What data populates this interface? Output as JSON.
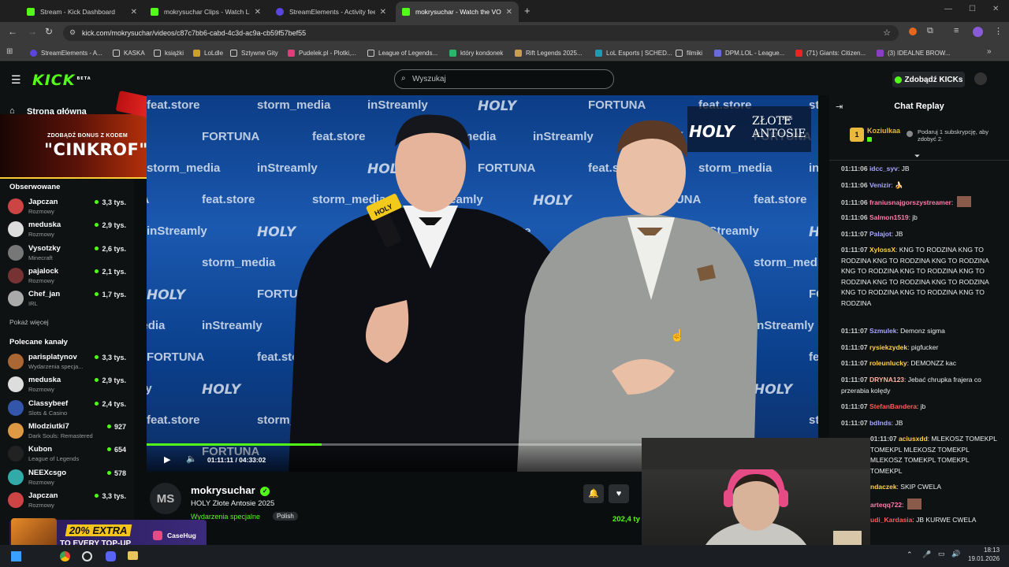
{
  "browser": {
    "tabs": [
      {
        "label": "Stream - Kick Dashboard",
        "color": "#53fc18",
        "active": false
      },
      {
        "label": "mokrysuchar Clips - Watch Live",
        "color": "#53fc18",
        "active": false
      },
      {
        "label": "StreamElements - Activity feed",
        "color": "#5b45e0",
        "active": false
      },
      {
        "label": "mokrysuchar - Watch the VOD",
        "color": "#53fc18",
        "active": true
      }
    ],
    "new_tab_icon": "plus-icon",
    "url": "kick.com/mokrysuchar/videos/c87c7bb6-cabd-4c3d-ac9a-cb59f57bef55",
    "bookmarks": [
      "StreamElements - A...",
      "KASKA",
      "książki",
      "LoLdle",
      "Sztywne Gity",
      "Pudelek.pl - Plotki,...",
      "League of Legends...",
      "który kondonek",
      "Rift Legends 2025...",
      "LoL Esports | SCHED...",
      "filmiki",
      "DPM.LOL - League...",
      "(71) Giants: Citizen...",
      "(3) IDEALNE BROW..."
    ]
  },
  "header": {
    "logo": "KICK",
    "logo_sup": "BETA",
    "search_placeholder": "Wyszukaj",
    "kicks_button": "Zdobądź KICKs"
  },
  "sidebar": {
    "home": "Strona główna",
    "promo": {
      "line1": "ZDOBĄDŹ BONUS Z KODEM",
      "code": "\"CINKROF\""
    },
    "followed_title": "Obserwowane",
    "followed": [
      {
        "name": "Japczan",
        "category": "Rozmowy",
        "viewers": "3,3 tys.",
        "color": "#c44"
      },
      {
        "name": "meduska",
        "category": "Rozmowy",
        "viewers": "2,9 tys.",
        "color": "#ddd"
      },
      {
        "name": "Vysotzky",
        "category": "Minecraft",
        "viewers": "2,6 tys.",
        "color": "#777"
      },
      {
        "name": "pajalock",
        "category": "Rozmowy",
        "viewers": "2,1 tys.",
        "color": "#733"
      },
      {
        "name": "Chef_jan",
        "category": "IRL",
        "viewers": "1,7 tys.",
        "color": "#aaa"
      }
    ],
    "show_more": "Pokaż więcej",
    "recommended_title": "Polecane kanały",
    "recommended": [
      {
        "name": "parisplatynov",
        "category": "Wydarzenia specja...",
        "viewers": "3,3 tys.",
        "color": "#a63"
      },
      {
        "name": "meduska",
        "category": "Rozmowy",
        "viewers": "2,9 tys.",
        "color": "#ddd"
      },
      {
        "name": "Classybeef",
        "category": "Slots & Casino",
        "viewers": "2,4 tys.",
        "color": "#35a"
      },
      {
        "name": "Mlodziutki7",
        "category": "Dark Souls: Remastered",
        "viewers": "927",
        "color": "#d94"
      },
      {
        "name": "Kubon",
        "category": "League of Legends",
        "viewers": "654",
        "color": "#222"
      },
      {
        "name": "NEEXcsgo",
        "category": "Rozmowy",
        "viewers": "578",
        "color": "#3aa"
      },
      {
        "name": "Japczan",
        "category": "Rozmowy",
        "viewers": "3,3 tys.",
        "color": "#c44"
      }
    ],
    "bottom_promo": {
      "line1": "20% EXTRA",
      "line2": "TO EVERY TOP-UP",
      "brand": "CaseHug"
    }
  },
  "video": {
    "overlay_logo": "HOLY",
    "overlay_title1": "ZŁOTE",
    "overlay_title2": "ANTOSIE",
    "overlay_year": "2025",
    "mic_label": "HOLY",
    "wall_words": [
      "feat.store",
      "storm_media",
      "inStreamly",
      "HOLY",
      "FORTUNA"
    ],
    "time": "01:11:11 / 04:33:02",
    "progress": 0.26
  },
  "channel": {
    "avatar": "MS",
    "name": "mokrysuchar",
    "title": "HOLY Złote Antosie 2025",
    "category": "Wydarzenia specjalne",
    "tag": "Polish",
    "views": "202,4 ty"
  },
  "chat": {
    "title": "Chat Replay",
    "top_supporter": {
      "name": "Koziulkaa",
      "rank": "1",
      "note": "Podaruj 1 subskrypcję, aby zdobyć 2."
    },
    "messages": [
      {
        "time": "01:11:06",
        "user": "idcc_syv",
        "color": "#a6a6ff",
        "text": "JB"
      },
      {
        "time": "01:11:06",
        "user": "Venizir",
        "color": "#a6a6ff",
        "text": "🍌"
      },
      {
        "time": "01:11:06",
        "user": "franiusnajgorszystreamer",
        "color": "#ff7aa8",
        "text": ""
      },
      {
        "time": "01:11:06",
        "user": "Salmon1519",
        "color": "#ff7aa8",
        "text": "jb"
      },
      {
        "time": "01:11:07",
        "user": "Palajot",
        "color": "#a6a6ff",
        "text": "JB"
      },
      {
        "time": "01:11:07",
        "user": "XylossX",
        "color": "#ffd24a",
        "text": "KNG TO RODZINA KNG TO RODZINA KNG TO RODZINA KNG TO RODZINA KNG TO RODZINA KNG TO RODZINA KNG TO RODZINA KNG TO RODZINA KNG TO RODZINA KNG TO RODZINA KNG TO RODZINA KNG TO RODZINA"
      },
      {
        "time": "01:11:07",
        "user": "Szmulek",
        "color": "#a6a6ff",
        "text": "Demonz sigma"
      },
      {
        "time": "01:11:07",
        "user": "rysiekzydek",
        "color": "#ffd24a",
        "text": "pigfucker"
      },
      {
        "time": "01:11:07",
        "user": "roleunlucky",
        "color": "#ffd24a",
        "text": "DEMONZZ kac"
      },
      {
        "time": "01:11:07",
        "user": "DRYNA123",
        "color": "#ffb0a0",
        "text": "Jebać chrupka frajera co przerabia kolędy"
      },
      {
        "time": "01:11:07",
        "user": "StefanBandera",
        "color": "#ff5a5a",
        "text": "jb"
      },
      {
        "time": "01:11:07",
        "user": "bdlnds",
        "color": "#a6a6ff",
        "text": "JB"
      },
      {
        "time": "01:11:07",
        "user": "aciusxdd",
        "color": "#ffd24a",
        "text": "MLEKOSZ TOMEKPL TOMEKPL MLEKOSZ TOMEKPL MLEKOSZ TOMEKPL TOMEKPL TOMEKPL"
      },
      {
        "time": "",
        "user": "ndaczek",
        "color": "#ffd24a",
        "text": "SKIP CWELA"
      },
      {
        "time": "",
        "user": "arteqq722",
        "color": "#ff7aa8",
        "text": ""
      },
      {
        "time": "",
        "user": "udi_Kardasia",
        "color": "#ff5a5a",
        "text": "JB KURWE CWELA"
      }
    ]
  },
  "taskbar": {
    "time": "18:13",
    "date": "19.01.2026"
  }
}
